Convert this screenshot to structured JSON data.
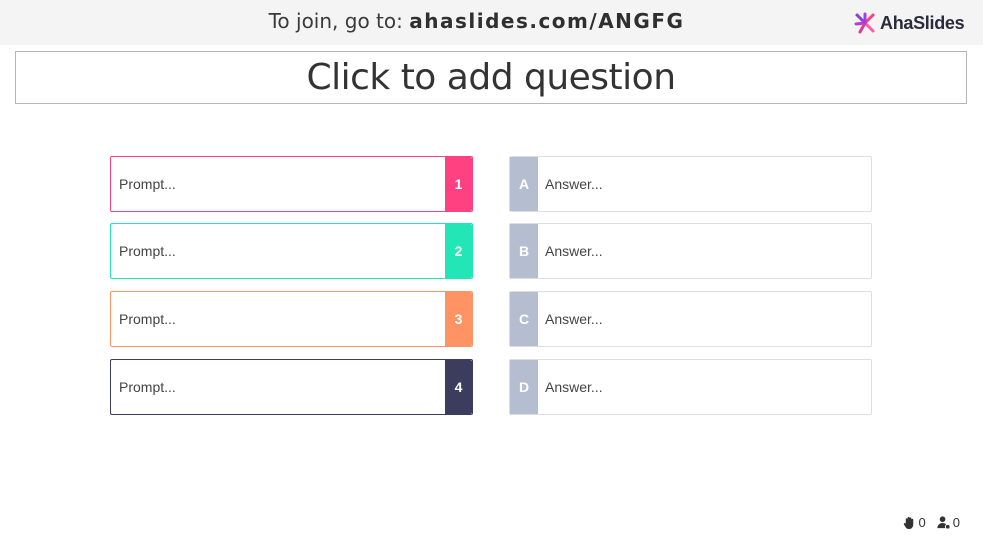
{
  "header": {
    "join_prefix": "To join, go to: ",
    "join_url": "ahaslides.com/ANGFG",
    "logo_text": "AhaSlides"
  },
  "question": {
    "placeholder": "Click to add question"
  },
  "pairs": [
    {
      "prompt": "Prompt...",
      "number": "1",
      "color": "#ff4081",
      "answer_letter": "A",
      "answer": "Answer..."
    },
    {
      "prompt": "Prompt...",
      "number": "2",
      "color": "#23e6b6",
      "answer_letter": "B",
      "answer": "Answer..."
    },
    {
      "prompt": "Prompt...",
      "number": "3",
      "color": "#ff9364",
      "answer_letter": "C",
      "answer": "Answer..."
    },
    {
      "prompt": "Prompt...",
      "number": "4",
      "color": "#3c3c5f",
      "answer_letter": "D",
      "answer": "Answer..."
    }
  ],
  "stats": {
    "hands_icon": "raised-hand-icon",
    "hands": "0",
    "participants_icon": "participant-icon",
    "participants": "0"
  },
  "colors": {
    "letter_badge": "#b5bed1",
    "top_bar": "#f4f4f4"
  }
}
